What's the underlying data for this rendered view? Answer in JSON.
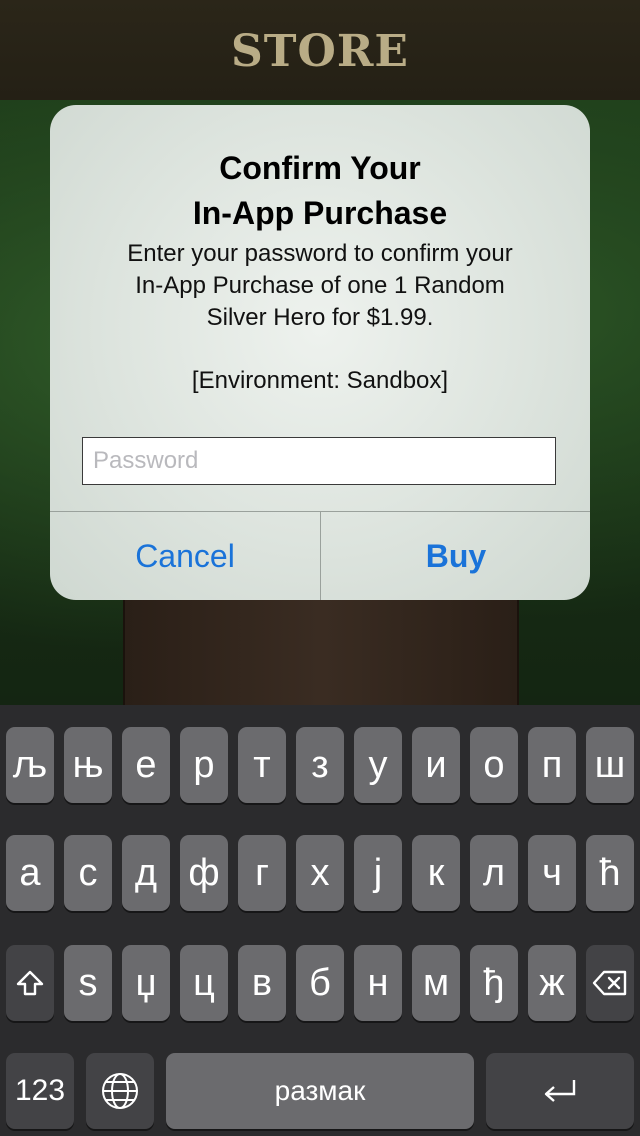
{
  "header": {
    "title": "STORE"
  },
  "alert": {
    "title_line1": "Confirm Your",
    "title_line2": "In-App Purchase",
    "message_line1": "Enter your password to confirm your",
    "message_line2": "In-App Purchase of one 1 Random",
    "message_line3": "Silver Hero for $1.99.",
    "environment": "[Environment: Sandbox]",
    "password_placeholder": "Password",
    "password_value": "",
    "cancel_label": "Cancel",
    "buy_label": "Buy",
    "action_color": "#1a73d9"
  },
  "keyboard": {
    "row1": [
      "љ",
      "њ",
      "е",
      "р",
      "т",
      "з",
      "у",
      "и",
      "о",
      "п",
      "ш"
    ],
    "row2": [
      "а",
      "с",
      "д",
      "ф",
      "г",
      "х",
      "ј",
      "к",
      "л",
      "ч",
      "ћ"
    ],
    "row3": [
      "ѕ",
      "џ",
      "ц",
      "в",
      "б",
      "н",
      "м",
      "ђ",
      "ж"
    ],
    "shift_icon": "shift-icon",
    "delete_icon": "backspace-icon",
    "numbers_label": "123",
    "globe_icon": "globe-icon",
    "space_label": "размак",
    "return_icon": "return-icon"
  }
}
